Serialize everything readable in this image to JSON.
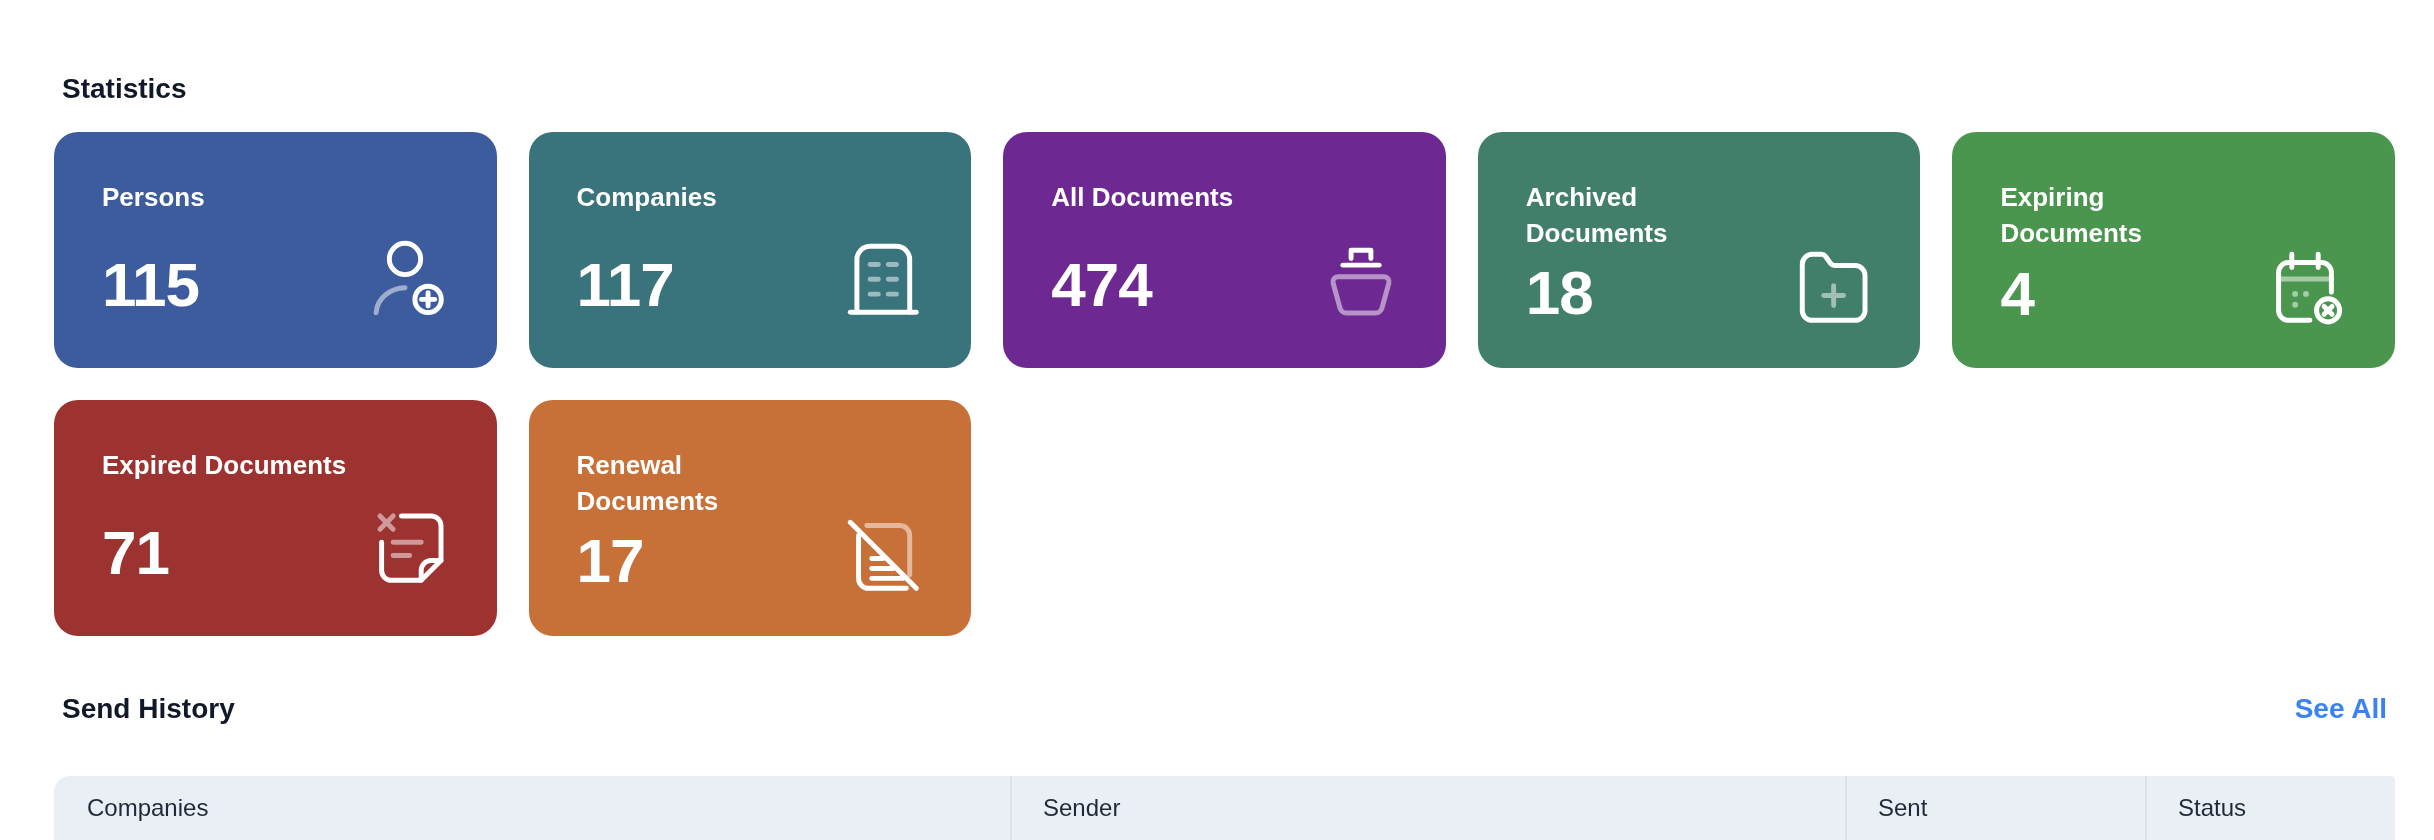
{
  "statistics": {
    "title": "Statistics",
    "cards": [
      {
        "label": "Persons",
        "value": "115",
        "color": "#3d5c9d"
      },
      {
        "label": "Companies",
        "value": "117",
        "color": "#39737b"
      },
      {
        "label": "All Documents",
        "value": "474",
        "color": "#6d2991"
      },
      {
        "label": "Archived Documents",
        "value": "18",
        "color": "#417f6a"
      },
      {
        "label": "Expiring Documents",
        "value": "4",
        "color": "#4b964f"
      },
      {
        "label": "Expired Documents",
        "value": "71",
        "color": "#9d3331"
      },
      {
        "label": "Renewal Documents",
        "value": "17",
        "color": "#c77139"
      }
    ]
  },
  "send_history": {
    "title": "Send History",
    "see_all": "See All",
    "table": {
      "columns": [
        "Companies",
        "Sender",
        "Sent",
        "Status"
      ]
    }
  }
}
